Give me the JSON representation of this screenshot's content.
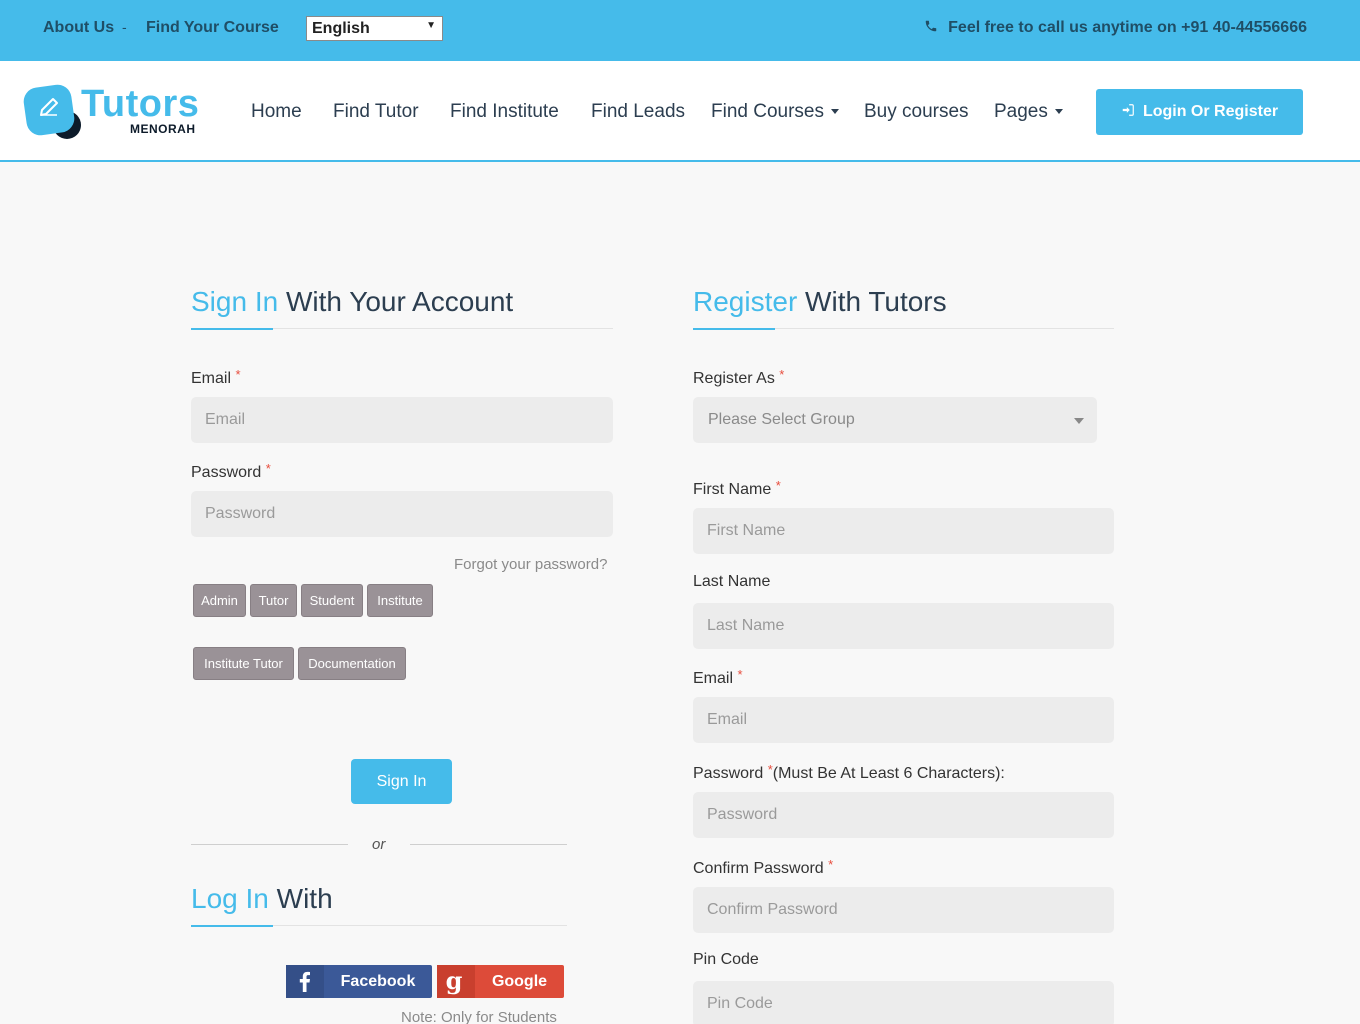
{
  "topbar": {
    "about_label": "About Us",
    "separator": "-",
    "find_course_label": "Find Your Course",
    "language": "English",
    "phone_text": "Feel free to call us anytime on +91 40-44556666"
  },
  "logo": {
    "word": "Tutors",
    "sub": "MENORAH"
  },
  "nav": {
    "items": [
      "Home",
      "Find Tutor",
      "Find Institute",
      "Find Leads",
      "Find Courses",
      "Buy courses",
      "Pages"
    ],
    "login_label": "Login Or Register"
  },
  "signin": {
    "title_highlight": "Sign In",
    "title_rest": " With Your Account",
    "email_label": "Email",
    "email_placeholder": "Email",
    "password_label": "Password",
    "password_placeholder": "Password",
    "forgot_label": "Forgot your password?",
    "roles": [
      "Admin",
      "Tutor",
      "Student",
      "Institute",
      "Institute Tutor",
      "Documentation"
    ],
    "submit_label": "Sign In",
    "or_label": "or"
  },
  "social": {
    "title_highlight": "Log In",
    "title_rest": " With",
    "facebook_label": "Facebook",
    "google_label": "Google",
    "note": "Note: Only for Students"
  },
  "register": {
    "title_highlight": "Register",
    "title_rest": " With Tutors",
    "register_as_label": "Register As",
    "group_placeholder": "Please Select Group",
    "first_name_label": "First Name",
    "first_name_placeholder": "First Name",
    "last_name_label": "Last Name",
    "last_name_placeholder": "Last Name",
    "email_label": "Email",
    "email_placeholder": "Email",
    "password_label": "Password",
    "password_hint": "(Must Be At Least 6 Characters):",
    "password_placeholder": "Password",
    "confirm_label": "Confirm Password",
    "confirm_placeholder": "Confirm Password",
    "pin_label": "Pin Code",
    "pin_placeholder": "Pin Code"
  },
  "required_mark": "*",
  "colors": {
    "accent": "#45bbea",
    "dark": "#2c3e50",
    "role_button": "#9a9297",
    "facebook": "#3b5998",
    "google": "#dd4b39"
  }
}
